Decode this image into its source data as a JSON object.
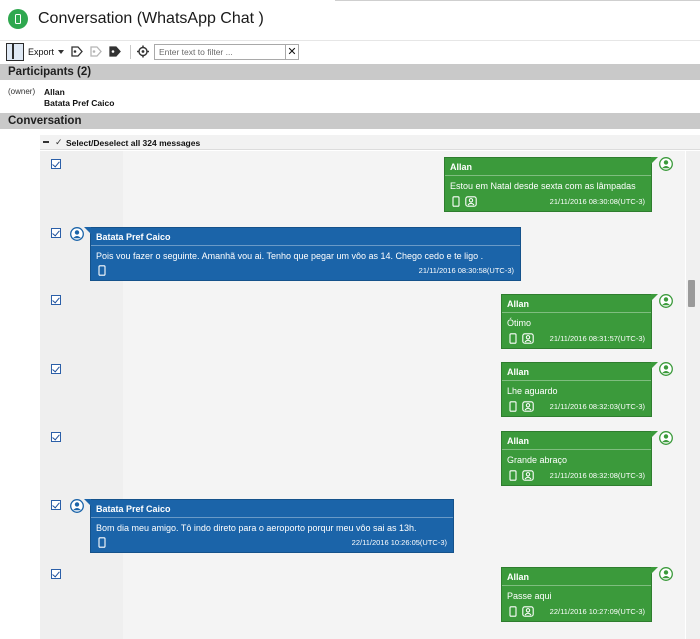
{
  "window": {
    "title": "Conversation (WhatsApp Chat )"
  },
  "toolbar": {
    "export_label": "Export",
    "filter_placeholder": "Enter text to filter ...",
    "clear_label": "✕"
  },
  "participants": {
    "header": "Participants (2)",
    "owner_tag": "(owner)",
    "names": [
      "Allan",
      "Batata Pref Caico"
    ]
  },
  "conversation": {
    "header": "Conversation",
    "select_all_label": "Select/Deselect all 324 messages",
    "messages": [
      {
        "sender": "Allan",
        "text": "Estou em Natal desde sexta com as lâmpadas",
        "timestamp": "21/11/2016 08:30:08(UTC-3)",
        "side": "right"
      },
      {
        "sender": "Batata Pref Caico",
        "text": "Pois vou fazer o seguinte. Amanhã vou ai. Tenho que pegar um vôo as 14.  Chego cedo e te ligo .",
        "timestamp": "21/11/2016 08:30:58(UTC-3)",
        "side": "left"
      },
      {
        "sender": "Allan",
        "text": "Ótimo",
        "timestamp": "21/11/2016 08:31:57(UTC-3)",
        "side": "right"
      },
      {
        "sender": "Allan",
        "text": "Lhe aguardo",
        "timestamp": "21/11/2016 08:32:03(UTC-3)",
        "side": "right"
      },
      {
        "sender": "Allan",
        "text": "Grande abraço",
        "timestamp": "21/11/2016 08:32:08(UTC-3)",
        "side": "right"
      },
      {
        "sender": "Batata Pref Caico",
        "text": "Bom dia meu amigo.  Tô indo direto para o aeroporto porqur meu vôo sai as 13h.",
        "timestamp": "22/11/2016 10:26:05(UTC-3)",
        "side": "left"
      },
      {
        "sender": "Allan",
        "text": "Passe aqui",
        "timestamp": "22/11/2016 10:27:09(UTC-3)",
        "side": "right"
      }
    ]
  },
  "colors": {
    "outgoing_bubble": "#3b9a3b",
    "incoming_bubble": "#1b64a9",
    "section_header": "#c9c9c9",
    "app_icon": "#2fa84f"
  }
}
